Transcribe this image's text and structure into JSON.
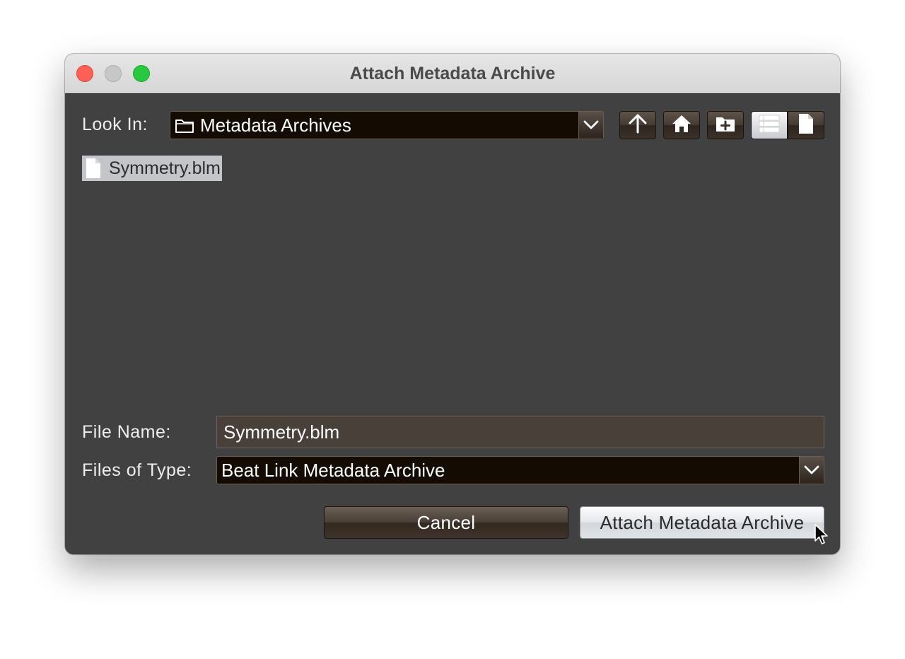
{
  "window": {
    "title": "Attach Metadata Archive"
  },
  "look_in": {
    "label": "Look In:",
    "value": "Metadata Archives",
    "icon": "folder-icon"
  },
  "toolbar": {
    "buttons": [
      {
        "name": "up-folder",
        "icon": "arrow-up-icon"
      },
      {
        "name": "home",
        "icon": "home-icon"
      },
      {
        "name": "new-folder",
        "icon": "new-folder-icon"
      },
      {
        "name": "list-view",
        "icon": "list-view-icon",
        "selected": true
      },
      {
        "name": "details-view",
        "icon": "document-icon",
        "selected": false
      }
    ]
  },
  "files": [
    {
      "name": "Symmetry.blm",
      "icon": "file-icon",
      "selected": true
    }
  ],
  "file_name": {
    "label": "File Name:",
    "value": "Symmetry.blm"
  },
  "file_type": {
    "label": "Files of Type:",
    "value": "Beat Link Metadata Archive"
  },
  "actions": {
    "cancel_label": "Cancel",
    "approve_label": "Attach Metadata Archive"
  },
  "colors": {
    "panel_background": "#414141",
    "combo_background": "#140c03",
    "close": "#fe5f57",
    "minimize": "#c7c7c7",
    "maximize": "#28c840"
  }
}
